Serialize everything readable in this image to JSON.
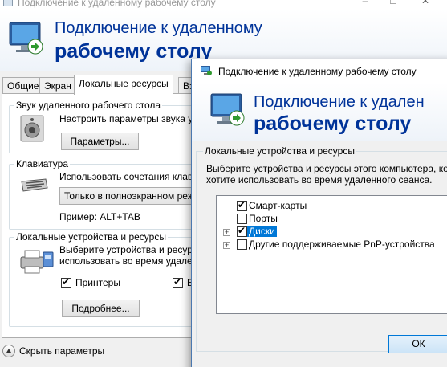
{
  "back_window": {
    "title": "Подключение к удаленному рабочему столу",
    "banner_line1": "Подключение к удаленному",
    "banner_line2": "рабочему столу",
    "tabs": [
      "Общие",
      "Экран",
      "Локальные ресурсы",
      "Взаи"
    ],
    "active_tab": 2,
    "sound": {
      "group_label": "Звук удаленного рабочего стола",
      "description": "Настроить параметры звука уда",
      "button": "Параметры..."
    },
    "keyboard": {
      "group_label": "Клавиатура",
      "description": "Использовать сочетания клавиш",
      "select_value": "Только в полноэкранном режим",
      "example": "Пример: ALT+TAB"
    },
    "local_devices": {
      "group_label": "Локальные устройства и ресурсы",
      "description_line1": "Выберите устройства и ресурсы",
      "description_line2": "использовать во время удаленн",
      "checkbox_printers": "Принтеры",
      "printers_checked": true,
      "checkbox_buffer": "Бу",
      "buffer_checked": true,
      "more_button": "Подробнее..."
    },
    "hide_options": "Скрыть параметры"
  },
  "dialog": {
    "title": "Подключение к удаленному рабочему столу",
    "banner_line1": "Подключение к удален",
    "banner_line2": "рабочему столу",
    "group_label": "Локальные устройства и ресурсы",
    "description_line1": "Выберите устройства и ресурсы этого компьютера, котор",
    "description_line2": "хотите использовать во время удаленного сеанса.",
    "items": [
      {
        "label": "Смарт-карты",
        "checked": true,
        "expandable": false,
        "selected": false
      },
      {
        "label": "Порты",
        "checked": false,
        "expandable": false,
        "selected": false
      },
      {
        "label": "Диски",
        "checked": true,
        "expandable": true,
        "selected": true
      },
      {
        "label": "Другие поддерживаемые PnP-устройства",
        "checked": false,
        "expandable": true,
        "selected": false
      }
    ],
    "ok_button": "ОК"
  },
  "colors": {
    "banner_text": "#003399",
    "selection": "#0078d7"
  }
}
